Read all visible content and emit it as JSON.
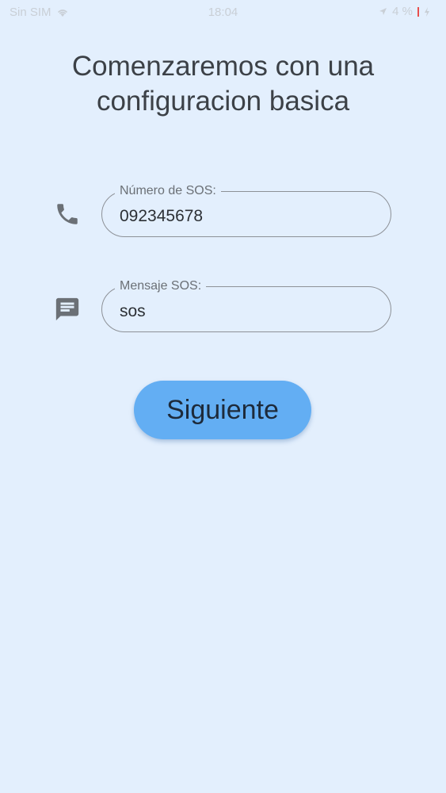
{
  "status_bar": {
    "carrier": "Sin SIM",
    "time": "18:04",
    "battery": "4 %"
  },
  "title": {
    "line1": "Comenzaremos con una",
    "line2": "configuracion basica"
  },
  "fields": {
    "sos_number": {
      "label": "Número de SOS:",
      "value": "092345678",
      "icon": "phone-icon"
    },
    "sos_message": {
      "label": "Mensaje SOS:",
      "value": "sos",
      "icon": "message-icon"
    }
  },
  "next_button": {
    "label": "Siguiente",
    "color": "#63aef3"
  },
  "colors": {
    "background": "#e3effd",
    "field_border": "#8d9197",
    "icon": "#6b7076"
  }
}
